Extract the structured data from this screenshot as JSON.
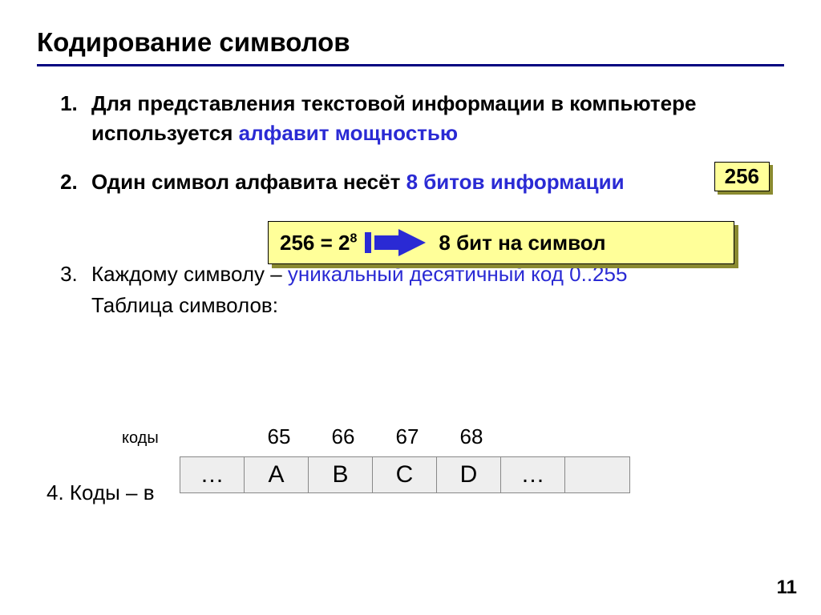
{
  "title": "Кодирование символов",
  "items": {
    "i1_a": "Для представления текстовой информации  в компьютере используется ",
    "i1_b": "алфавит мощностью",
    "i2_a": "Один символ алфавита несёт ",
    "i2_b": "8 битов информации",
    "i3_a": " Каждому символу – ",
    "i3_b": "уникальный десятичный код 0..255",
    "i3_sub": "Таблица символов:",
    "i4": "4. Коды – в"
  },
  "callout256": "256",
  "formula": {
    "left_a": "256 = 2",
    "left_exp": "8",
    "right": "8 бит на символ"
  },
  "codes": {
    "label": "коды",
    "numbers": [
      "65",
      "66",
      "67",
      "68"
    ],
    "symbols": [
      "…",
      "A",
      "B",
      "C",
      "D",
      "…",
      ""
    ]
  },
  "page_number": "11"
}
